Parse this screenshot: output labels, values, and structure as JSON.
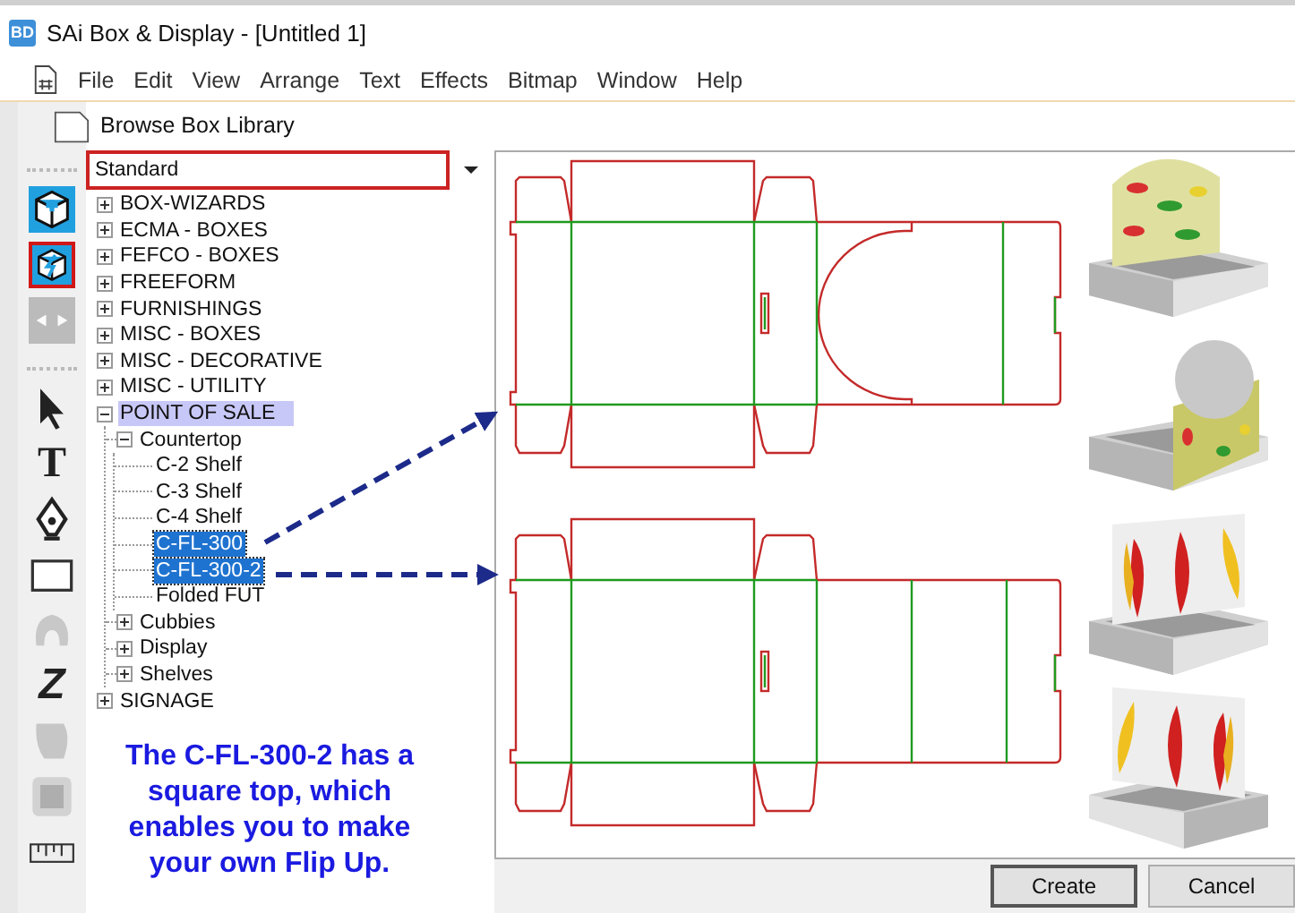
{
  "window": {
    "app_icon": "BD",
    "title": "SAi Box & Display - [Untitled 1]"
  },
  "menu": [
    "File",
    "Edit",
    "View",
    "Arrange",
    "Text",
    "Effects",
    "Bitmap",
    "Window",
    "Help"
  ],
  "toolbar": [
    {
      "kind": "box-plus",
      "selected": false,
      "disabled": false
    },
    {
      "kind": "box-bolt",
      "selected": true,
      "disabled": false
    },
    {
      "kind": "resize",
      "selected": false,
      "disabled": true
    },
    {
      "kind": "pointer",
      "selected": false,
      "disabled": false
    },
    {
      "kind": "text",
      "glyph": "T",
      "selected": false,
      "disabled": false
    },
    {
      "kind": "pen",
      "selected": false,
      "disabled": false
    },
    {
      "kind": "rectangle",
      "selected": false,
      "disabled": false
    },
    {
      "kind": "blob",
      "selected": false,
      "disabled": true
    },
    {
      "kind": "zigzag",
      "glyph": "Z",
      "selected": false,
      "disabled": false
    },
    {
      "kind": "fill",
      "selected": false,
      "disabled": true
    },
    {
      "kind": "frame",
      "selected": false,
      "disabled": true
    },
    {
      "kind": "ruler",
      "selected": false,
      "disabled": false
    }
  ],
  "dialog": {
    "title": "Browse Box Library",
    "library": {
      "value": "Standard"
    },
    "tree": [
      {
        "label": "BOX-WIZARDS",
        "expanded": false,
        "selected": false,
        "hover": false
      },
      {
        "label": "ECMA - BOXES",
        "expanded": false,
        "selected": false,
        "hover": false
      },
      {
        "label": "FEFCO - BOXES",
        "expanded": false,
        "selected": false,
        "hover": false
      },
      {
        "label": "FREEFORM",
        "expanded": false,
        "selected": false,
        "hover": false
      },
      {
        "label": "FURNISHINGS",
        "expanded": false,
        "selected": false,
        "hover": false
      },
      {
        "label": "MISC - BOXES",
        "expanded": false,
        "selected": false,
        "hover": false
      },
      {
        "label": "MISC - DECORATIVE",
        "expanded": false,
        "selected": false,
        "hover": false
      },
      {
        "label": "MISC - UTILITY",
        "expanded": false,
        "selected": false,
        "hover": false
      },
      {
        "label": "POINT OF SALE",
        "expanded": true,
        "selected": false,
        "hover": true,
        "children": [
          {
            "label": "Countertop",
            "expanded": true,
            "selected": false,
            "hover": false,
            "children": [
              {
                "label": "C-2 Shelf",
                "selected": false,
                "hover": false
              },
              {
                "label": "C-3 Shelf",
                "selected": false,
                "hover": false
              },
              {
                "label": "C-4 Shelf",
                "selected": false,
                "hover": false
              },
              {
                "label": "C-FL-300",
                "selected": true,
                "hover": false
              },
              {
                "label": "C-FL-300-2",
                "selected": true,
                "hover": false
              },
              {
                "label": "Folded FUT",
                "selected": false,
                "hover": false
              }
            ]
          },
          {
            "label": "Cubbies",
            "expanded": false,
            "selected": false,
            "hover": false
          },
          {
            "label": "Display",
            "expanded": false,
            "selected": false,
            "hover": false
          },
          {
            "label": "Shelves",
            "expanded": false,
            "selected": false,
            "hover": false
          }
        ]
      },
      {
        "label": "SIGNAGE",
        "expanded": false,
        "selected": false,
        "hover": false
      }
    ],
    "note": "The C-FL-300-2 has a square top, which enables you to make your own Flip Up.",
    "previews": [
      {
        "kind": "round-top"
      },
      {
        "kind": "square-top"
      }
    ],
    "buttons": [
      "Create",
      "Cancel"
    ]
  }
}
